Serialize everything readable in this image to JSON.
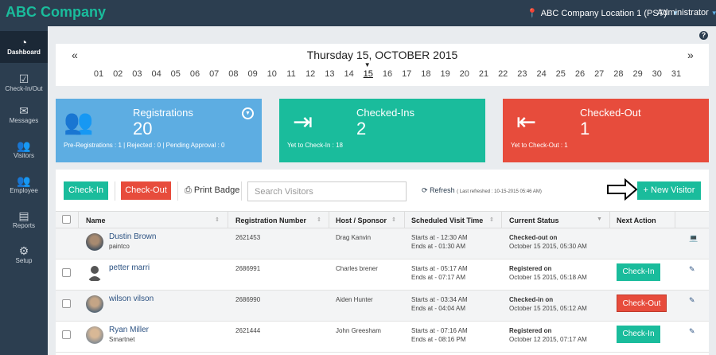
{
  "app": {
    "brand": "ABC Company",
    "location": "ABC Company Location 1 (PST)",
    "user": "Administrator"
  },
  "sidebar": {
    "items": [
      {
        "label": "Dashboard",
        "icon": "dashboard-icon",
        "glyph": "◔"
      },
      {
        "label": "Check-In/Out",
        "icon": "checkin-icon",
        "glyph": "☑"
      },
      {
        "label": "Messages",
        "icon": "envelope-icon",
        "glyph": "✉"
      },
      {
        "label": "Visitors",
        "icon": "users-icon",
        "glyph": "👥"
      },
      {
        "label": "Employee",
        "icon": "employee-icon",
        "glyph": "👥"
      },
      {
        "label": "Reports",
        "icon": "bar-chart-icon",
        "glyph": "▤"
      },
      {
        "label": "Setup",
        "icon": "gear-icon",
        "glyph": "⚙"
      }
    ]
  },
  "help": "?",
  "calendar": {
    "title": "Thursday 15, OCTOBER 2015",
    "prev": "«",
    "next": "»",
    "selected": "15",
    "days": [
      "01",
      "02",
      "03",
      "04",
      "05",
      "06",
      "07",
      "08",
      "09",
      "10",
      "11",
      "12",
      "13",
      "14",
      "15",
      "16",
      "17",
      "18",
      "19",
      "20",
      "21",
      "22",
      "23",
      "24",
      "25",
      "26",
      "27",
      "28",
      "29",
      "30",
      "31"
    ]
  },
  "cards": {
    "registrations": {
      "title": "Registrations",
      "value": "20",
      "sub": "Pre-Registrations : 1 | Rejected : 0 | Pending Approval : 0"
    },
    "checkedins": {
      "title": "Checked-Ins",
      "value": "2",
      "sub": "Yet to Check-In : 18"
    },
    "checkedout": {
      "title": "Checked-Out",
      "value": "1",
      "sub": "Yet to Check-Out : 1"
    }
  },
  "toolbar": {
    "checkin": "Check-In",
    "checkout": "Check-Out",
    "print": "Print Badge",
    "search_placeholder": "Search Visitors",
    "refresh": "Refresh",
    "last_refreshed": "( Last refreshed : 10-15-2015 05:46 AM)",
    "new_visitor": "+ New Visitor"
  },
  "table": {
    "headers": [
      "Name",
      "Registration Number",
      "Host / Sponsor",
      "Scheduled Visit Time",
      "Current Status",
      "Next Action"
    ],
    "rows": [
      {
        "name": "Dustin Brown",
        "company": "paintco",
        "reg": "2621453",
        "host": "Drag Kanvin",
        "starts": "Starts at - 12:30 AM",
        "ends": "Ends at - 01:30 AM",
        "status": "Checked-out on",
        "status_date": "October 15 2015, 05:30 AM",
        "action": "",
        "avatar": "photo"
      },
      {
        "name": "petter marri",
        "company": "",
        "reg": "2686991",
        "host": "Charles brener",
        "starts": "Starts at - 05:17 AM",
        "ends": "Ends at - 07:17 AM",
        "status": "Registered on",
        "status_date": "October 15 2015, 05:18 AM",
        "action": "Check-In",
        "avatar": "placeholder"
      },
      {
        "name": "wilson vilson",
        "company": "",
        "reg": "2686990",
        "host": "Aiden Hunter",
        "starts": "Starts at - 03:34 AM",
        "ends": "Ends at - 04:04 AM",
        "status": "Checked-in on",
        "status_date": "October 15 2015, 05:12 AM",
        "action": "Check-Out",
        "avatar": "photo"
      },
      {
        "name": "Ryan Miller",
        "company": "Smartnet",
        "reg": "2621444",
        "host": "John Greesham",
        "starts": "Starts at - 07:16 AM",
        "ends": "Ends at - 08:16 PM",
        "status": "Registered on",
        "status_date": "October 12 2015, 07:17 AM",
        "action": "Check-In",
        "avatar": "photo"
      }
    ]
  },
  "colors": {
    "teal": "#1abc9c",
    "blue": "#5dade2",
    "red": "#e74c3c",
    "nav": "#2c3e50"
  }
}
